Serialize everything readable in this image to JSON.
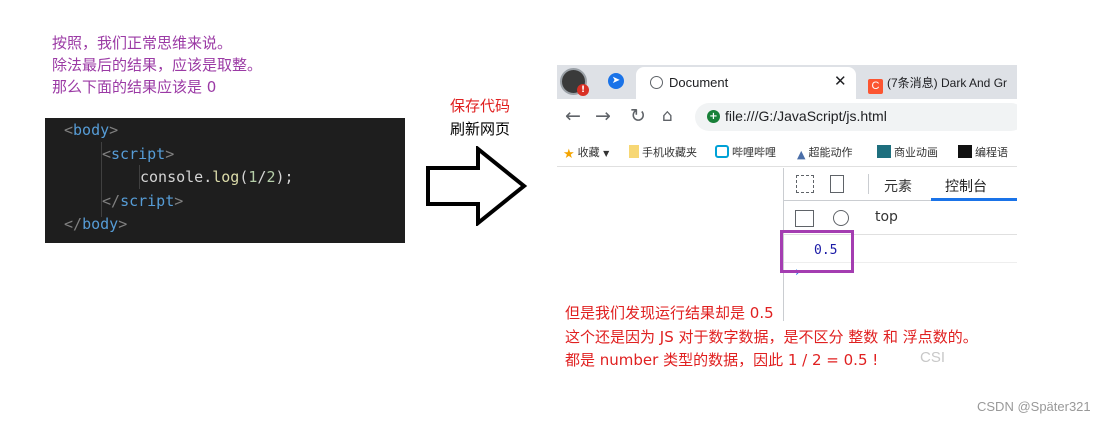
{
  "notes": [
    "按照，我们正常思维来说。",
    "除法最后的结果，应该是取整。",
    "那么下面的结果应该是 0"
  ],
  "code": {
    "line1_tag": "body",
    "line2_tag": "script",
    "line3_obj": "console.",
    "line3_fn": "log",
    "line3_num1": "1",
    "line3_op": "/",
    "line3_num2": "2",
    "line3_end": ");",
    "line4_tag": "script",
    "line5_tag": "body"
  },
  "caption": {
    "line1": "保存代码",
    "line2": "刷新网页"
  },
  "browser": {
    "tab_active_title": "Document",
    "tab_close": "✕",
    "tab2_icon": "C",
    "tab2_title": "(7条消息) Dark And Gr",
    "url": "file:///G:/JavaScript/js.html",
    "bookmarks": [
      "收藏",
      "手机收藏夹",
      "哔哩哔哩",
      "超能动作",
      "商业动画",
      "编程语"
    ],
    "devtools_tabs": [
      "元素",
      "控制台"
    ],
    "context": "top",
    "console_output": "0.5",
    "console_prompt": "›"
  },
  "explain": [
    "但是我们发现运行结果却是 0.5",
    "这个还是因为 JS 对于数字数据，是不区分 整数 和 浮点数的。",
    "都是 number 类型的数据，因此 1 / 2 = 0.5 !"
  ],
  "faint_watermark": "CSI",
  "watermark": "CSDN @Später321",
  "colors": {
    "note_purple": "#9b3aa5",
    "caption_red": "#e02020",
    "highlight_border": "#a43db1",
    "code_bg": "#1e1e1e"
  }
}
